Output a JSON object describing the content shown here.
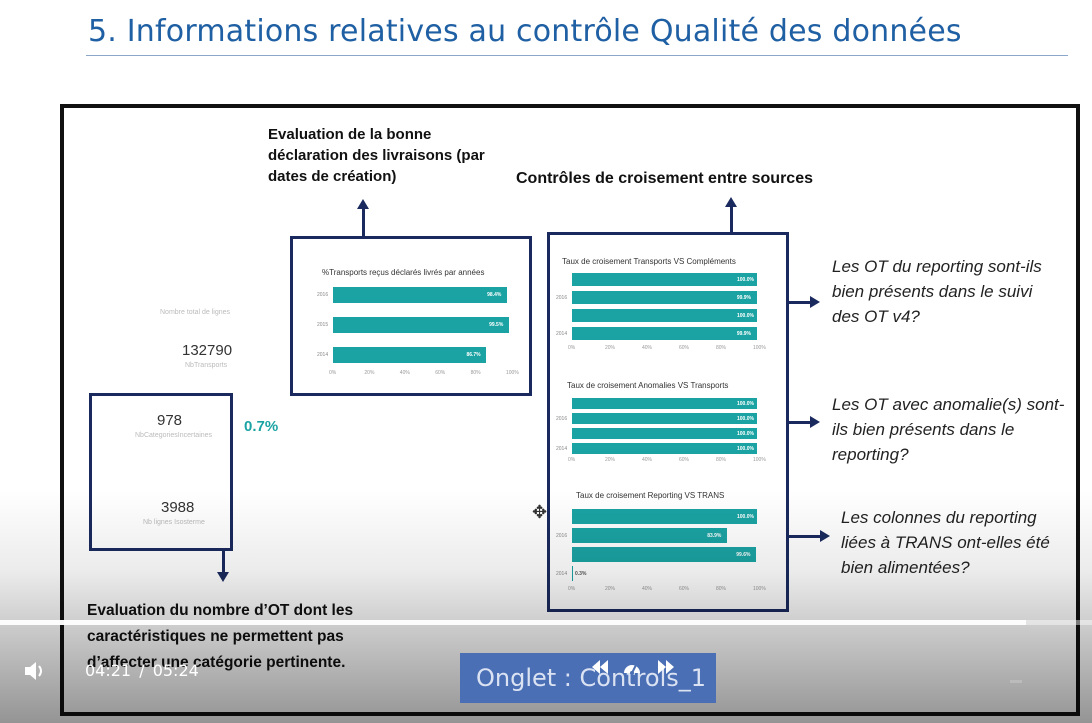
{
  "slide": {
    "title": "5. Informations relatives au contrôle Qualité des données"
  },
  "headings": {
    "eval_livraisons": "Evaluation de la bonne déclaration des livraisons (par dates de création)",
    "controles": "Contrôles de croisement entre sources",
    "eval_ot": "Evaluation du nombre d’OT dont les caractéristiques ne permettent pas d’affecter une catégorie pertinente."
  },
  "kpis": {
    "total_label": "Nombre total de lignes",
    "total_value": "132790",
    "total_sub": "NbTransports",
    "cat_value": "978",
    "cat_sub": "NbCategoriesIncertaines",
    "cat_pct": "0.7%",
    "lines_value": "3988",
    "lines_sub": "Nb lignes Isosterme"
  },
  "questions": {
    "q1": "Les OT du reporting sont-ils bien présents dans le suivi des OT v4?",
    "q2": "Les OT avec anomalie(s) sont-ils bien présents dans le reporting?",
    "q3": "Les colonnes du reporting liées à TRANS ont-elles été bien alimentées?"
  },
  "chart_data": [
    {
      "type": "bar",
      "title": "%Transports reçus déclarés livrés par années",
      "categories": [
        "2016",
        "2015",
        "2014"
      ],
      "values": [
        98.4,
        99.5,
        86.7
      ],
      "value_labels": [
        "98.4%",
        "99.5%",
        "86.7%"
      ],
      "xlim": [
        0,
        100
      ],
      "x_ticks": [
        "0%",
        "20%",
        "40%",
        "60%",
        "80%",
        "100%"
      ],
      "color": "#1ba3a3"
    },
    {
      "type": "bar",
      "title": "Taux de croisement Transports VS Compléments",
      "categories": [
        "",
        "2016",
        "",
        "2014"
      ],
      "values": [
        100,
        99.9,
        100,
        99.9
      ],
      "value_labels": [
        "100.0%",
        "99.9%",
        "100.0%",
        "99.9%"
      ],
      "xlim": [
        0,
        100
      ],
      "x_ticks": [
        "0%",
        "20%",
        "40%",
        "60%",
        "80%",
        "100%"
      ],
      "color": "#1ba3a3"
    },
    {
      "type": "bar",
      "title": "Taux de croisement Anomalies VS Transports",
      "categories": [
        "",
        "2016",
        "",
        "2014"
      ],
      "values": [
        100,
        100,
        100,
        100
      ],
      "value_labels": [
        "100.0%",
        "100.0%",
        "100.0%",
        "100.0%"
      ],
      "xlim": [
        0,
        100
      ],
      "x_ticks": [
        "0%",
        "20%",
        "40%",
        "60%",
        "80%",
        "100%"
      ],
      "color": "#1ba3a3"
    },
    {
      "type": "bar",
      "title": "Taux de croisement Reporting VS TRANS",
      "categories": [
        "",
        "2016",
        "",
        "2014"
      ],
      "values": [
        100,
        83.9,
        99.6,
        0.3
      ],
      "value_labels": [
        "100.0%",
        "83.9%",
        "99.6%",
        "0.3%"
      ],
      "xlim": [
        0,
        100
      ],
      "x_ticks": [
        "0%",
        "20%",
        "40%",
        "60%",
        "80%",
        "100%"
      ],
      "color": "#1ba3a3"
    }
  ],
  "player": {
    "time_current": "04:21",
    "time_separator": "/",
    "time_total": "05:24",
    "progress": 0.94,
    "tab_button": "Onglet : Controls_1",
    "icons": {
      "volume": "volume-icon",
      "rewind": "rewind-icon",
      "speed": "speed-icon",
      "forward": "forward-icon",
      "minimize": "minimize-icon"
    }
  }
}
